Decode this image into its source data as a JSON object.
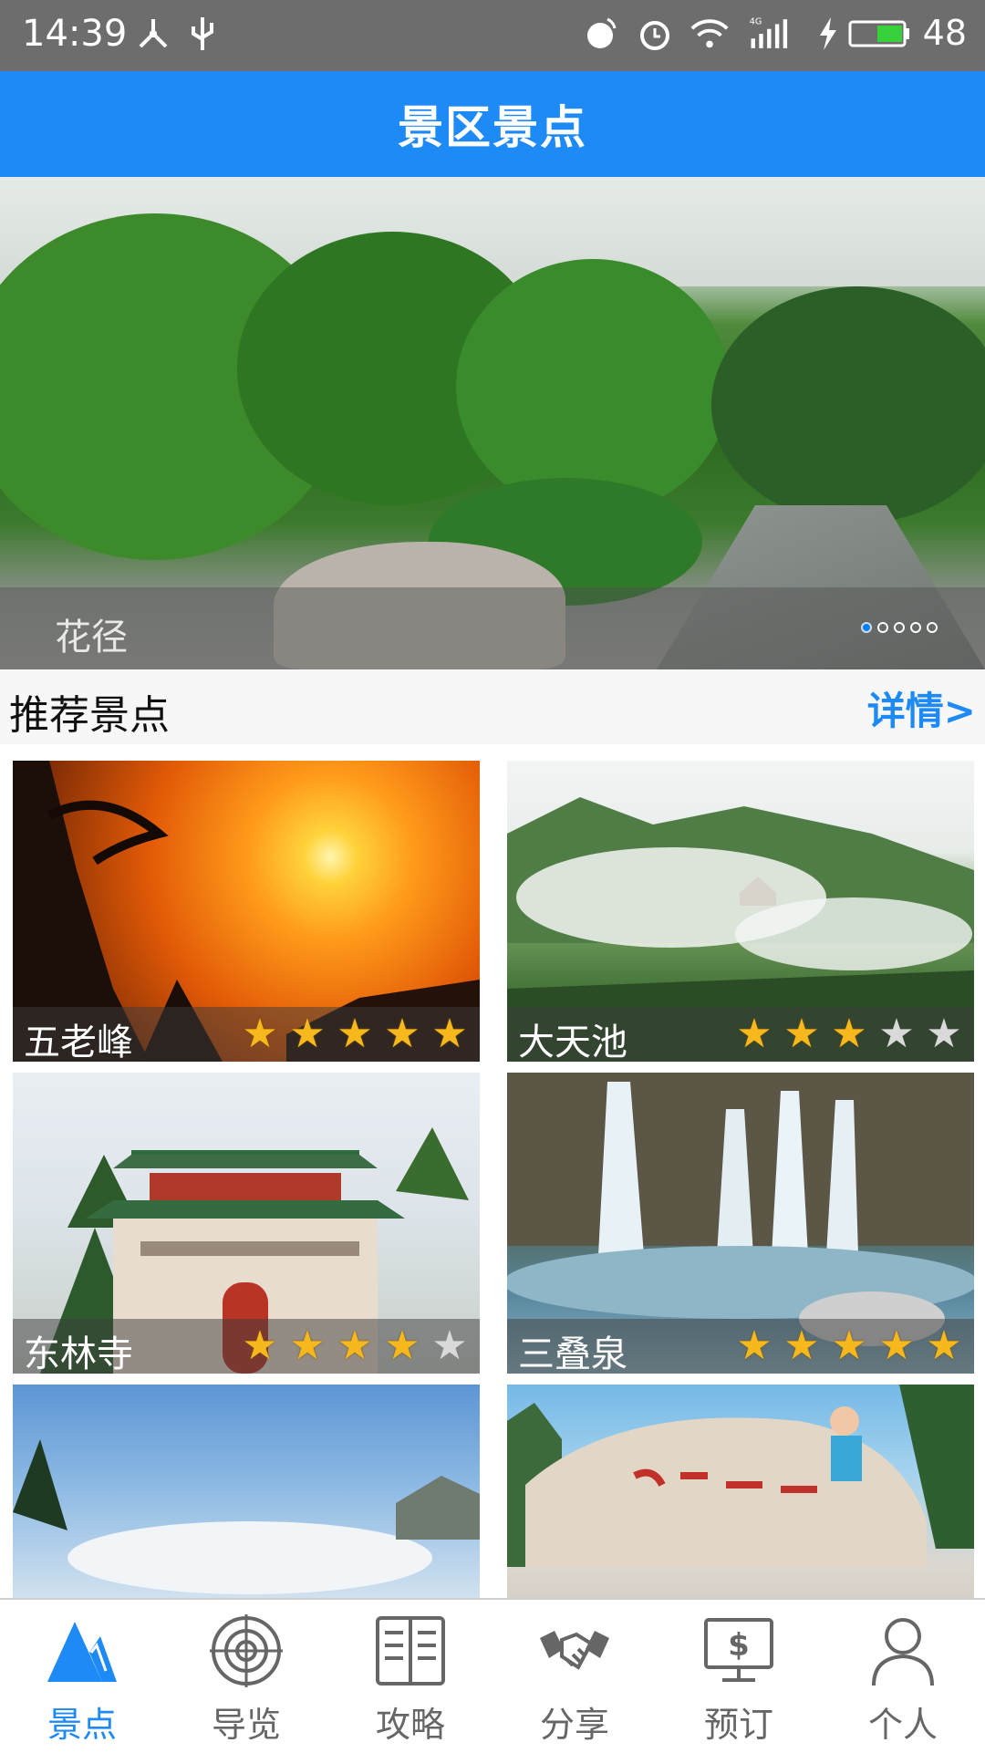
{
  "status_bar": {
    "time": "14:39",
    "battery": "48",
    "network": "4G",
    "icons": [
      "usb-tether-icon",
      "usb-icon",
      "nfc-icon",
      "alarm-icon",
      "wifi-icon",
      "signal-icon",
      "charging-icon",
      "battery-icon"
    ]
  },
  "header": {
    "title": "景区景点"
  },
  "banner": {
    "caption": "花径",
    "slide_count": 5,
    "active_slide": 1
  },
  "section": {
    "title": "推荐景点",
    "more_label": "详情>"
  },
  "attractions": [
    {
      "name": "五老峰",
      "rating": 5,
      "theme": "sunset"
    },
    {
      "name": "大天池",
      "rating": 3,
      "theme": "mist"
    },
    {
      "name": "东林寺",
      "rating": 4,
      "theme": "temple"
    },
    {
      "name": "三叠泉",
      "rating": 5,
      "theme": "waterfall"
    },
    {
      "name": "",
      "rating": 0,
      "theme": "sky"
    },
    {
      "name": "",
      "rating": 0,
      "theme": "rock"
    }
  ],
  "nav": {
    "items": [
      {
        "label": "景点",
        "icon": "mountain-icon",
        "active": true
      },
      {
        "label": "导览",
        "icon": "target-icon",
        "active": false
      },
      {
        "label": "攻略",
        "icon": "book-icon",
        "active": false
      },
      {
        "label": "分享",
        "icon": "handshake-icon",
        "active": false
      },
      {
        "label": "预订",
        "icon": "payment-screen-icon",
        "active": false
      },
      {
        "label": "个人",
        "icon": "person-icon",
        "active": false
      }
    ]
  },
  "colors": {
    "primary": "#1e8af5",
    "star": "#f6b81d",
    "nav_inactive": "#666666"
  }
}
